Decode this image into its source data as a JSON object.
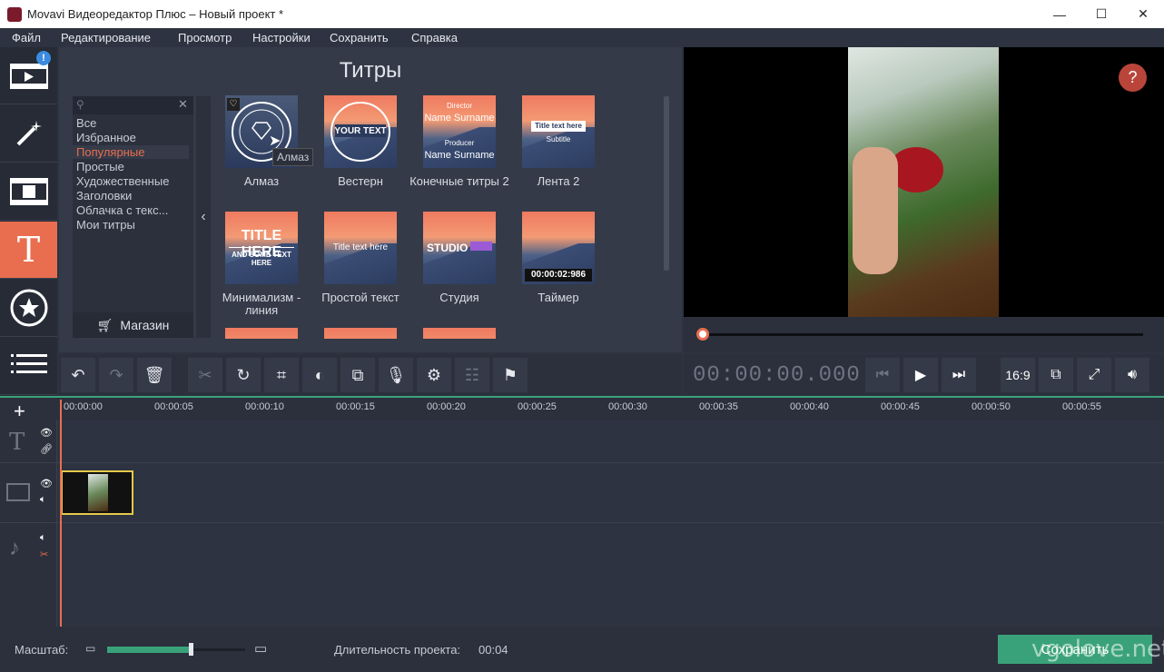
{
  "window": {
    "title": "Movavi Видеоредактор Плюс – Новый проект *",
    "min": "—",
    "max": "☐",
    "close": "✕"
  },
  "menu": [
    "Файл",
    "Редактирование",
    "Просмотр",
    "Настройки",
    "Сохранить",
    "Справка"
  ],
  "nav": {
    "badge": "!",
    "items": [
      "import",
      "filters",
      "transitions",
      "titles",
      "stickers",
      "more"
    ]
  },
  "titles_panel": {
    "heading": "Титры",
    "categories": [
      "Все",
      "Избранное",
      "Популярные",
      "Простые",
      "Художественные",
      "Заголовки",
      "Облачка с текс...",
      "Мои титры"
    ],
    "selected_category": "Популярные",
    "shop_label": "Магазин",
    "tiles": [
      {
        "label": "Алмаз",
        "overlay": "",
        "tooltip": "Алмаз"
      },
      {
        "label": "Вестерн",
        "overlay": "YOUR TEXT"
      },
      {
        "label": "Конечные титры 2",
        "overlay": "Director",
        "overlay2": "Name Surname",
        "overlay3": "Producer",
        "overlay4": "Name Surname"
      },
      {
        "label": "Лента 2",
        "overlay": "Title text here",
        "overlay2": "Subtitle"
      },
      {
        "label": "Минимализм - линия",
        "overlay": "TITLE HERE",
        "overlay2": "AND SOME TEXT HERE"
      },
      {
        "label": "Простой текст",
        "overlay": "Title text here"
      },
      {
        "label": "Студия",
        "overlay": "STUDIO"
      },
      {
        "label": "Таймер",
        "overlay": "00:00:02:986"
      }
    ]
  },
  "preview": {
    "help": "?",
    "aspect": "16:9"
  },
  "player": {
    "timecode": "00:00:00.000"
  },
  "timeline": {
    "ticks": [
      "00:00:00",
      "00:00:05",
      "00:00:10",
      "00:00:15",
      "00:00:20",
      "00:00:25",
      "00:00:30",
      "00:00:35",
      "00:00:40",
      "00:00:45",
      "00:00:50",
      "00:00:55"
    ]
  },
  "bottom": {
    "scale_label": "Масштаб:",
    "scale_level": 0.61,
    "duration_label": "Длительность проекта:",
    "duration_value": "00:04",
    "save_label": "Сохранить",
    "watermark": "vgolove.net"
  },
  "colors": {
    "accent": "#e96e4f",
    "green": "#3aa27a",
    "bg": "#2d3340"
  }
}
